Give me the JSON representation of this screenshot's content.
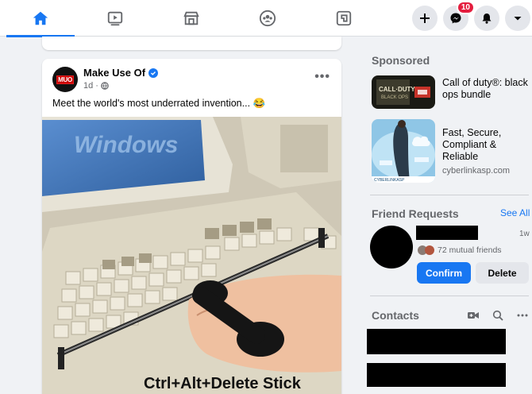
{
  "nav": {
    "tabs": [
      {
        "name": "home",
        "active": true
      },
      {
        "name": "watch",
        "active": false
      },
      {
        "name": "marketplace",
        "active": false
      },
      {
        "name": "groups",
        "active": false
      },
      {
        "name": "gaming",
        "active": false
      }
    ],
    "messenger_badge": "10",
    "accent_color": "#1877f2"
  },
  "post": {
    "author": "Make Use Of",
    "avatar_text": "MUO",
    "time": "1d",
    "text": "Meet the world's most underrated invention... 😂",
    "image_caption": "Ctrl+Alt+Delete Stick",
    "image_logo_text": "Windows"
  },
  "sponsored": {
    "title": "Sponsored",
    "ads": [
      {
        "title": "Call of duty®: black ops bundle",
        "domain": ""
      },
      {
        "title": "Fast, Secure, Compliant & Reliable",
        "domain": "cyberlinkasp.com"
      }
    ]
  },
  "friend_requests": {
    "title": "Friend Requests",
    "see_all": "See All",
    "time": "1w",
    "mutual": "72 mutual friends",
    "confirm": "Confirm",
    "delete": "Delete"
  },
  "contacts": {
    "title": "Contacts"
  }
}
